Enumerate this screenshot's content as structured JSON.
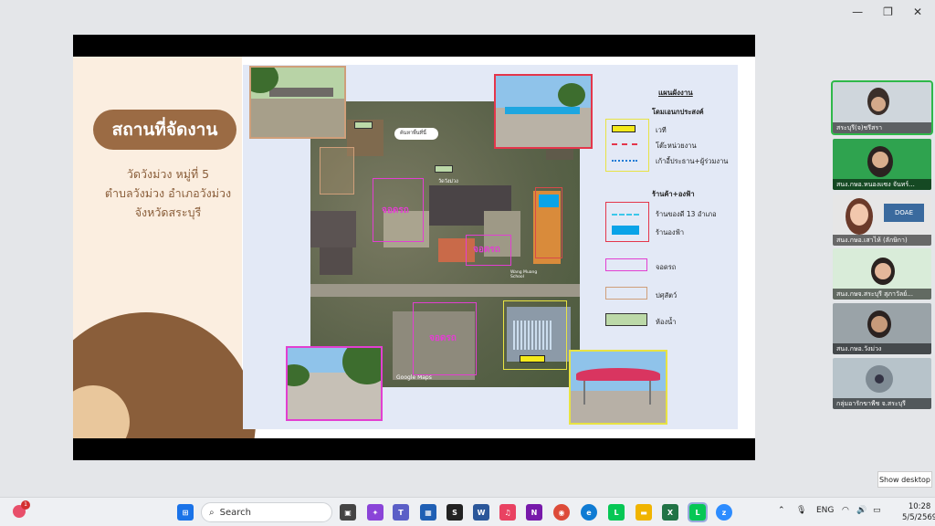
{
  "slide": {
    "title": "สถานที่จัดงาน",
    "address_line1": "วัดวังม่วง หมู่ที่ 5",
    "address_line2": "ตำบลวังม่วง อำเภอวังม่วง",
    "address_line3": "จังหวัดสระบุรี"
  },
  "map": {
    "search_chip": "ค้นหาพื้นที่นี้",
    "temple_label": "วัดวังม่วง",
    "parking_label_1": "จอดรถ",
    "parking_label_2": "จอดรถ",
    "parking_label_3": "จอดรถ",
    "school_label": "Wang Muang School",
    "attribution": "Google Maps"
  },
  "legend": {
    "title": "แผนผังงาน",
    "section1": "โดมเอนกประสงค์",
    "stage": "เวที",
    "tables": "โต๊ะหน่วยงาน",
    "chairs": "เก้าอี้ประธาน+ผู้ร่วมงาน",
    "section2": "ร้านค้า+องฟ้า",
    "shop13": "ร้านของดี 13 อำเภอ",
    "shopblue": "ร้านองฟ้า",
    "parking": "จอดรถ",
    "livestock": "ปศุสัตว์",
    "toilet": "ห้องน้ำ"
  },
  "participants": [
    {
      "name": "สระบุรี(จ)ชรีสรา"
    },
    {
      "name": "สนง.กษอ.หนองแซง จันทร์..."
    },
    {
      "name": "สนง.กษอ.เสาไห้ (ลักษิกา)"
    },
    {
      "name": "สนง.กษจ.สระบุรี สุภาวัลย์..."
    },
    {
      "name": "สนง.กษอ.วังม่วง"
    },
    {
      "name": "กลุ่มอารักขาพืช จ.สระบุรี"
    }
  ],
  "tooltip": "Show desktop",
  "taskbar": {
    "search": "Search",
    "lang": "ENG",
    "time": "10:28",
    "date": "5/5/2569",
    "notif_count": "1"
  },
  "colors": {
    "title_brown": "#9b6b44",
    "marker_pink": "#e23fd1",
    "accent_green": "#2fb84a"
  }
}
